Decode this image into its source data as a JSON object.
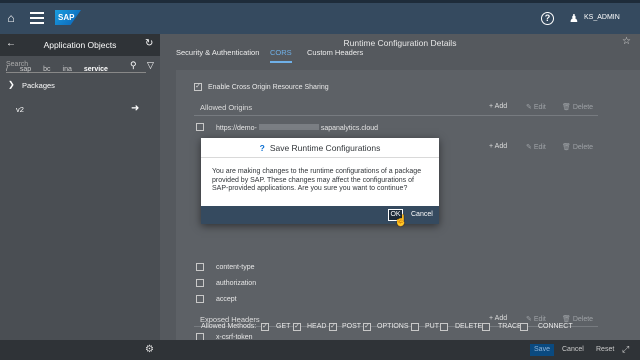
{
  "shell": {
    "logo": "SAP",
    "user": "KS_ADMIN",
    "help_icon": "?",
    "home_icon": "⌂",
    "user_icon": "♟"
  },
  "left": {
    "title": "Application Objects",
    "search_placeholder": "Search",
    "breadcrumbs": [
      "/",
      "sap",
      "bc",
      "ina",
      "service"
    ],
    "packages_label": "Packages",
    "item": "v2"
  },
  "right": {
    "title": "Runtime Configuration Details",
    "tabs": [
      "Security & Authentication",
      "CORS",
      "Custom Headers"
    ],
    "enable_cors": "Enable Cross Origin Resource Sharing",
    "allowed_origins": "Allowed Origins",
    "origin_prefix": "https://demo-",
    "origin_suffix": "sapanalytics.cloud",
    "add": "Add",
    "edit": "Edit",
    "delete": "Delete",
    "headers": [
      "content-type",
      "authorization",
      "accept"
    ],
    "exposed_headers": "Exposed Headers",
    "exposed_items": [
      "x-csrf-token"
    ],
    "methods_label": "Allowed Methods:",
    "methods": [
      "GET",
      "HEAD",
      "POST",
      "OPTIONS",
      "PUT",
      "DELETE",
      "TRACE",
      "CONNECT"
    ]
  },
  "footer": {
    "save": "Save",
    "cancel": "Cancel",
    "reset": "Reset"
  },
  "dialog": {
    "title": "Save Runtime Configurations",
    "icon": "?",
    "body": "You are making changes to the runtime configurations of a package provided by SAP. These changes may affect the configurations of SAP-provided applications. Are you sure you want to continue?",
    "ok": "OK",
    "cancel": "Cancel"
  }
}
